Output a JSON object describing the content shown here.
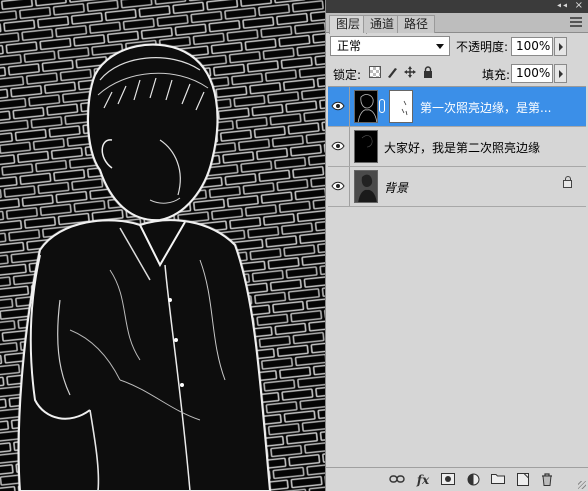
{
  "panel": {
    "tabs": [
      {
        "label": "图层",
        "active": true
      },
      {
        "label": "通道",
        "active": false
      },
      {
        "label": "路径",
        "active": false
      }
    ],
    "collapse_glyph": "◂◂",
    "close_glyph": "×"
  },
  "options": {
    "blend_mode": "正常",
    "opacity_label": "不透明度:",
    "opacity_value": "100%",
    "lock_label": "锁定:",
    "fill_label": "填充:",
    "fill_value": "100%"
  },
  "layers": [
    {
      "name": "第一次照亮边缘，是第...",
      "selected": true,
      "visible": true,
      "has_mask": true
    },
    {
      "name": "大家好，我是第二次照亮边缘",
      "selected": false,
      "visible": true,
      "has_mask": false
    },
    {
      "name": "背景",
      "selected": false,
      "visible": true,
      "locked": true
    }
  ],
  "bottom_icons": [
    "link-icon",
    "fx-icon",
    "mask-icon",
    "adjustment-icon",
    "group-folder-icon",
    "new-layer-icon",
    "trash-icon"
  ],
  "colors": {
    "selection": "#3b8fe8",
    "panel_bg": "#d6d6d6",
    "canvas_bg": "#050505"
  }
}
